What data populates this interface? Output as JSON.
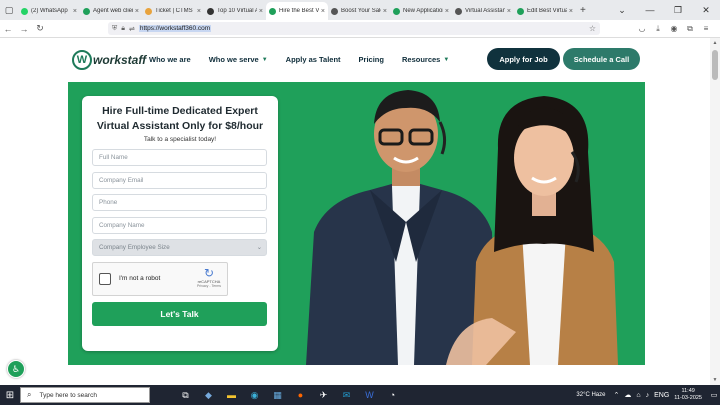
{
  "browser": {
    "tabs": [
      {
        "label": "(2) WhatsApp",
        "color": "#25d366"
      },
      {
        "label": "Agent web clien",
        "color": "#1fa05a"
      },
      {
        "label": "Ticket | CTMS",
        "color": "#e8a33d"
      },
      {
        "label": "Top 10 Virtual A",
        "color": "#333333"
      },
      {
        "label": "Hire the Best Vi",
        "color": "#1fa05a",
        "active": true
      },
      {
        "label": "Boost Your Sales",
        "color": "#555555"
      },
      {
        "label": "New Application",
        "color": "#1fa05a"
      },
      {
        "label": "Virtual Assistant",
        "color": "#555555"
      },
      {
        "label": "Edit Best Virtua",
        "color": "#1fa05a"
      }
    ],
    "url": "https://workstaff360.com"
  },
  "header": {
    "logo_text": "workstaff",
    "nav": [
      {
        "label": "Who we are",
        "dropdown": false
      },
      {
        "label": "Who we serve",
        "dropdown": true
      },
      {
        "label": "Apply as Talent",
        "dropdown": false
      },
      {
        "label": "Pricing",
        "dropdown": false
      },
      {
        "label": "Resources",
        "dropdown": true
      }
    ],
    "apply_label": "Apply for Job",
    "call_label": "Schedule a Call"
  },
  "hero": {
    "form": {
      "title_line1": "Hire Full-time Dedicated Expert",
      "title_line2": "Virtual Assistant Only for $8/hour",
      "subtitle": "Talk to a specialist today!",
      "fields": {
        "full_name": "Full Name",
        "company_email": "Company Email",
        "phone": "Phone",
        "company_name": "Company Name"
      },
      "employee_size": "Company Employee Size",
      "recaptcha_label": "I'm not a robot",
      "recaptcha_brand": "reCAPTCHA",
      "recaptcha_terms": "Privacy - Terms",
      "submit_label": "Let's Talk"
    },
    "accent_color": "#1fa05a"
  },
  "taskbar": {
    "search_placeholder": "Type here to search",
    "weather": "32°C  Haze",
    "language": "ENG",
    "time": "11:49",
    "date": "11-03-2025"
  }
}
